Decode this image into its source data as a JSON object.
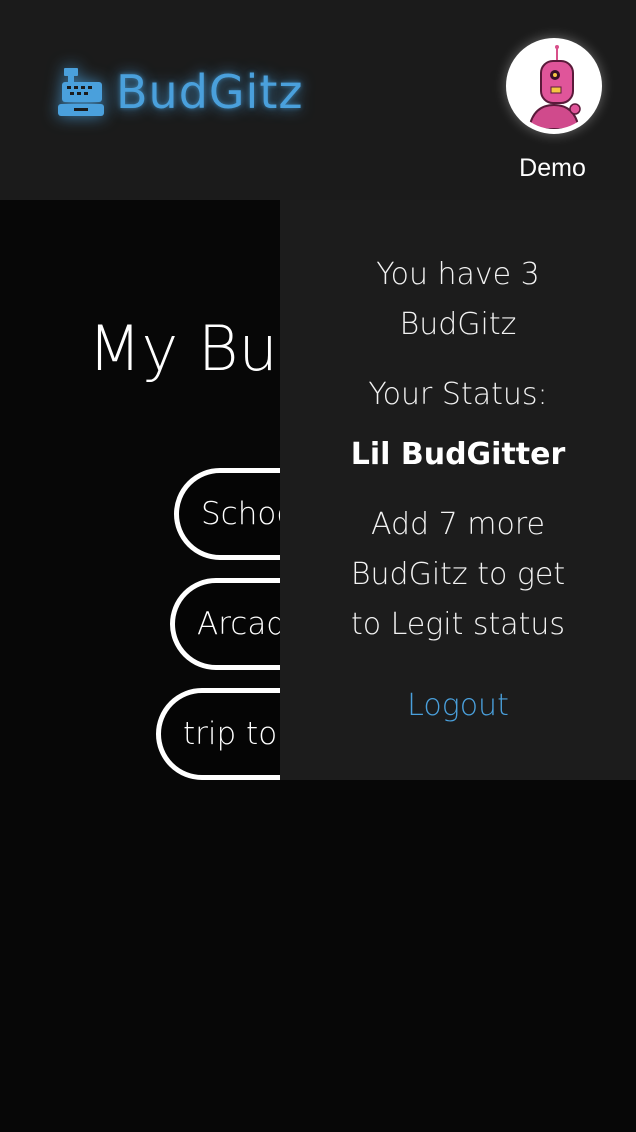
{
  "header": {
    "logo_text": "BudGitz",
    "username": "Demo",
    "logo_icon": "cash-register-icon",
    "avatar": "robot-avatar"
  },
  "main": {
    "title": "My Bu",
    "budgets": [
      {
        "label": "Schoo"
      },
      {
        "label": "Arcad"
      },
      {
        "label": "trip to"
      }
    ]
  },
  "dropdown": {
    "count_line_1": "You have 3",
    "count_line_2": "BudGitz",
    "status_label": "Your Status:",
    "status_value": "Lil BudGitter",
    "progress_line_1": "Add 7 more",
    "progress_line_2": "BudGitz to get",
    "progress_line_3": "to Legit status",
    "logout_label": "Logout"
  },
  "colors": {
    "accent": "#4aa0dc",
    "header_bg": "#1b1b1b",
    "panel_bg": "#1c1c1c",
    "page_bg": "#070707"
  }
}
